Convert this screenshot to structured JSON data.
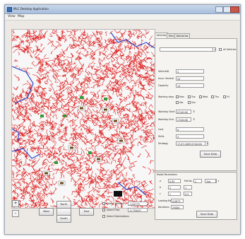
{
  "window": {
    "title": "MLC Desktop Application"
  },
  "menu": {
    "items": [
      "View",
      "Map"
    ]
  },
  "map": {
    "zoom_in": "+",
    "zoom_out": "–",
    "buttons": {
      "up": "North",
      "left": "West",
      "right": "East",
      "down": "South"
    },
    "checkboxes": [
      "Select Vehicles",
      "Select Files",
      "Select Destinations"
    ],
    "coords": [
      "-1.02775",
      "-5.776437"
    ]
  },
  "tabs": [
    "Vehicles",
    "Files",
    "Deliveries"
  ],
  "vehicles": {
    "all_vehicles_label": "all Vehicles",
    "fields": [
      {
        "label": "VehicleID",
        "value": "4"
      },
      {
        "label": "Insur. Serial#",
        "value": "20"
      },
      {
        "label": "Capacity",
        "value": "14"
      }
    ],
    "working_days_label": "Working days",
    "days_row1": [
      "Mon",
      "Tue",
      "Wed",
      "Thu",
      "Fri"
    ],
    "days_row2": [
      "Sat",
      "Sun"
    ],
    "workday_start": {
      "label": "Workday Start",
      "value": "07:00:00"
    },
    "workday_end": {
      "label": "Workday End",
      "value": "17:00:00"
    },
    "misc_fields": [
      {
        "label": "Cost",
        "value": "0"
      },
      {
        "label": "Skills",
        "value": "4"
      },
      {
        "label": "Strategy",
        "value": "17.07.2009 07:00:00"
      }
    ],
    "save_button": "Save Data"
  },
  "model": {
    "group_title": "Model Parameters",
    "rows": [
      {
        "label": "a",
        "v1": "0.95",
        "mid": "Pat.No.",
        "v2": "1",
        "v3": "1kg"
      },
      {
        "label": "b",
        "v1": "2",
        "mid": "",
        "v2": "1",
        "v3": ""
      },
      {
        "label": "c",
        "v1": "1",
        "mid": "",
        "v2": "0.5",
        "v3": ""
      }
    ],
    "loading_rate": {
      "label": "Loading Rate",
      "value": "0.0875"
    },
    "iterations": {
      "label": "Iterations",
      "value": "25000"
    },
    "save_button": "Save Data"
  },
  "colors": {
    "roads": "#dd1e1e",
    "water": "#2b47c9",
    "parks": "#2f9a3a"
  }
}
